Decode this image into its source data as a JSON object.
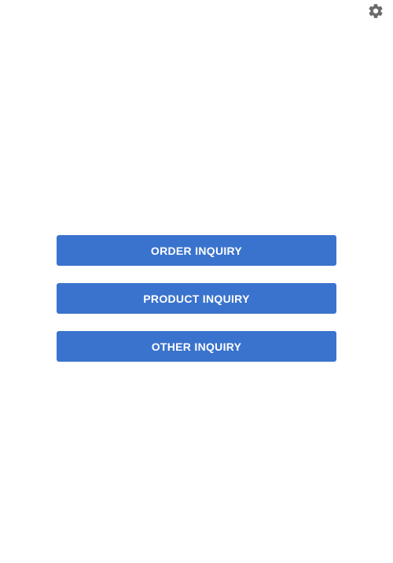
{
  "header": {
    "settings_icon": "gear-icon"
  },
  "buttons": {
    "order_inquiry": "ORDER INQUIRY",
    "product_inquiry": "PRODUCT INQUIRY",
    "other_inquiry": "OTHER INQUIRY"
  },
  "colors": {
    "button_background": "#3a73cd",
    "button_text": "#ffffff",
    "icon": "#6b6b6b",
    "page_background": "#ffffff"
  }
}
